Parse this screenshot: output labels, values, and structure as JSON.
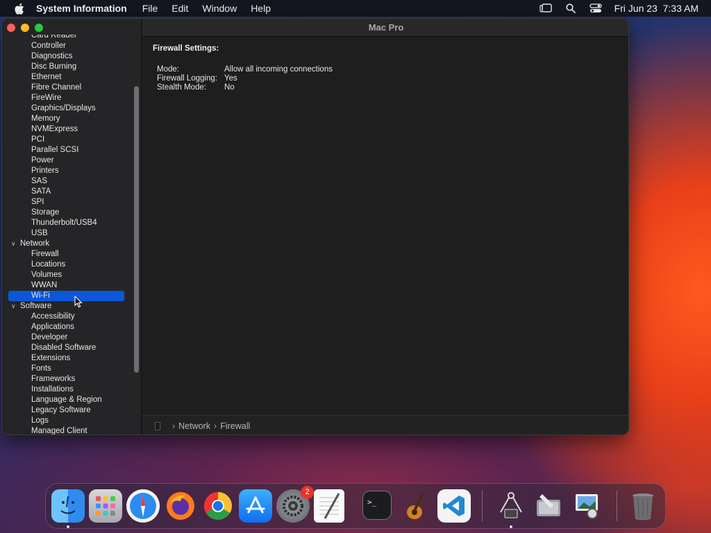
{
  "menubar": {
    "app_name": "System Information",
    "menus": [
      "File",
      "Edit",
      "Window",
      "Help"
    ],
    "clock": "Fri Jun 23  7:33 AM"
  },
  "window": {
    "title": "Mac Pro"
  },
  "sidebar": {
    "items": [
      {
        "label": "Card Reader",
        "type": "item"
      },
      {
        "label": "Controller",
        "type": "item"
      },
      {
        "label": "Diagnostics",
        "type": "item"
      },
      {
        "label": "Disc Burning",
        "type": "item"
      },
      {
        "label": "Ethernet",
        "type": "item"
      },
      {
        "label": "Fibre Channel",
        "type": "item"
      },
      {
        "label": "FireWire",
        "type": "item"
      },
      {
        "label": "Graphics/Displays",
        "type": "item"
      },
      {
        "label": "Memory",
        "type": "item"
      },
      {
        "label": "NVMExpress",
        "type": "item"
      },
      {
        "label": "PCI",
        "type": "item"
      },
      {
        "label": "Parallel SCSI",
        "type": "item"
      },
      {
        "label": "Power",
        "type": "item"
      },
      {
        "label": "Printers",
        "type": "item"
      },
      {
        "label": "SAS",
        "type": "item"
      },
      {
        "label": "SATA",
        "type": "item"
      },
      {
        "label": "SPI",
        "type": "item"
      },
      {
        "label": "Storage",
        "type": "item"
      },
      {
        "label": "Thunderbolt/USB4",
        "type": "item"
      },
      {
        "label": "USB",
        "type": "item"
      },
      {
        "label": "Network",
        "type": "group"
      },
      {
        "label": "Firewall",
        "type": "item"
      },
      {
        "label": "Locations",
        "type": "item"
      },
      {
        "label": "Volumes",
        "type": "item"
      },
      {
        "label": "WWAN",
        "type": "item"
      },
      {
        "label": "Wi-Fi",
        "type": "item",
        "selected": true
      },
      {
        "label": "Software",
        "type": "group"
      },
      {
        "label": "Accessibility",
        "type": "item"
      },
      {
        "label": "Applications",
        "type": "item"
      },
      {
        "label": "Developer",
        "type": "item"
      },
      {
        "label": "Disabled Software",
        "type": "item"
      },
      {
        "label": "Extensions",
        "type": "item"
      },
      {
        "label": "Fonts",
        "type": "item"
      },
      {
        "label": "Frameworks",
        "type": "item"
      },
      {
        "label": "Installations",
        "type": "item"
      },
      {
        "label": "Language & Region",
        "type": "item"
      },
      {
        "label": "Legacy Software",
        "type": "item"
      },
      {
        "label": "Logs",
        "type": "item"
      },
      {
        "label": "Managed Client",
        "type": "item"
      }
    ]
  },
  "main": {
    "section_title": "Firewall Settings:",
    "fields": [
      {
        "key": "Mode:",
        "value": "Allow all incoming connections"
      },
      {
        "key": "Firewall Logging:",
        "value": "Yes"
      },
      {
        "key": "Stealth Mode:",
        "value": "No"
      }
    ],
    "path": [
      "Network",
      "Firewall"
    ]
  },
  "dock": {
    "apps": [
      {
        "name": "finder-icon",
        "running": true
      },
      {
        "name": "launchpad-icon"
      },
      {
        "name": "safari-icon"
      },
      {
        "name": "firefox-icon"
      },
      {
        "name": "chrome-icon"
      },
      {
        "name": "app-store-icon"
      },
      {
        "name": "system-settings-icon",
        "badge": "2"
      },
      {
        "name": "textedit-icon"
      },
      {
        "name": "terminal-icon"
      },
      {
        "name": "garageband-icon"
      },
      {
        "name": "vscode-icon"
      }
    ],
    "right_apps": [
      {
        "name": "system-information-icon",
        "running": true
      },
      {
        "name": "disk-utility-icon"
      },
      {
        "name": "preview-icon"
      },
      {
        "name": "trash-icon"
      }
    ]
  }
}
